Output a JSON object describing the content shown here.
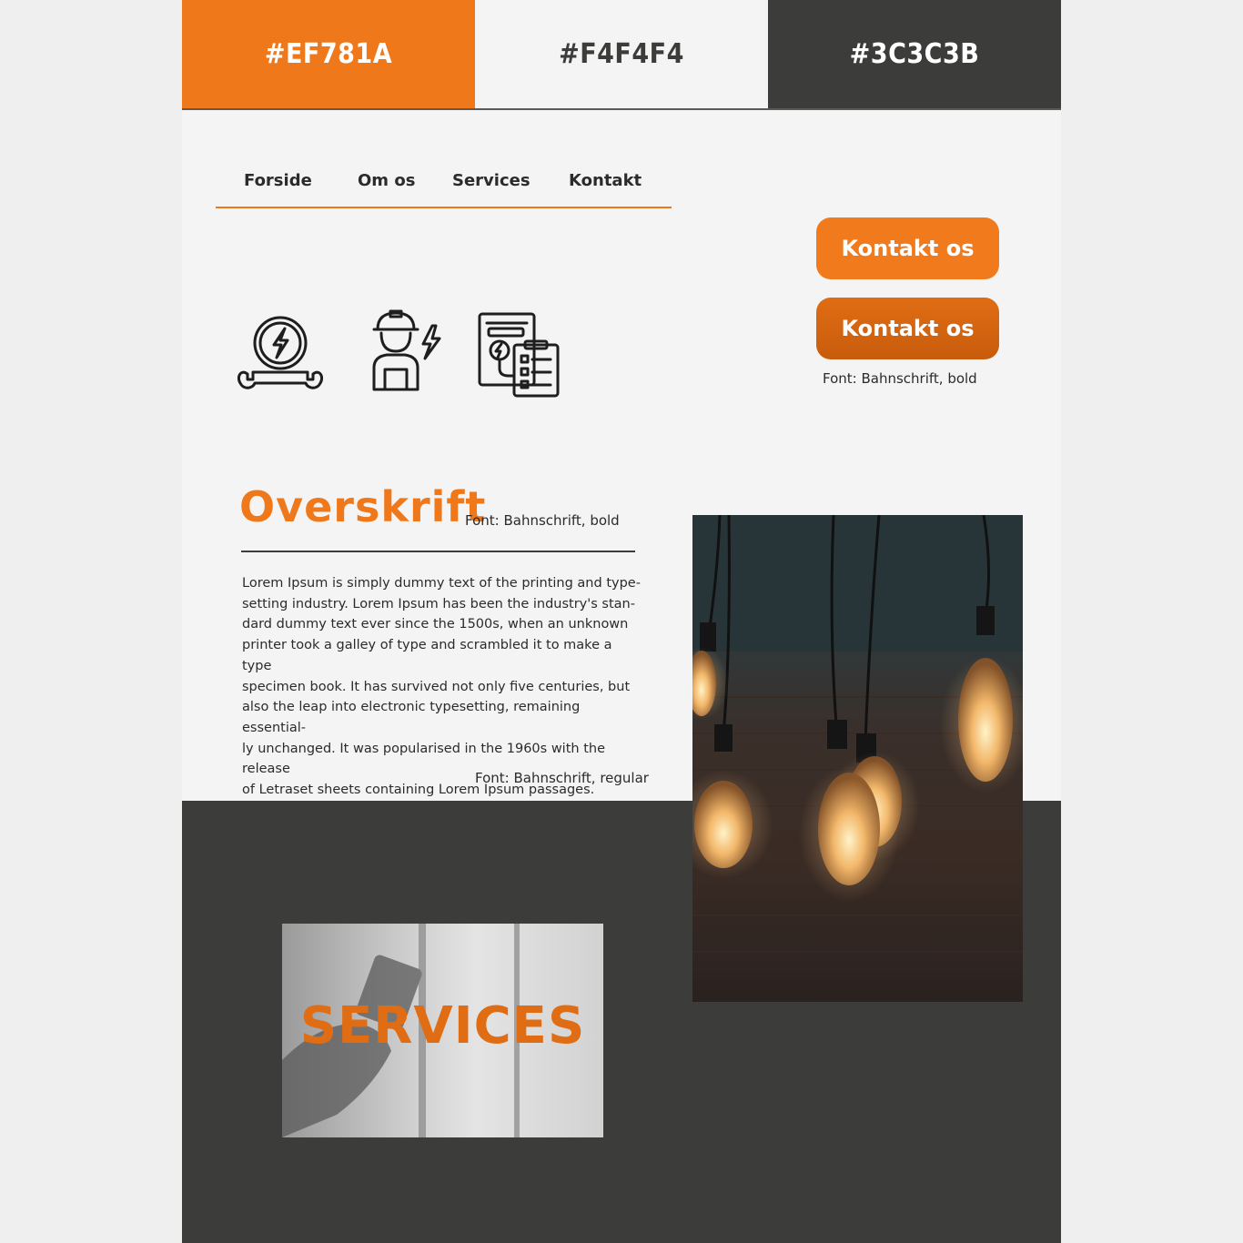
{
  "swatches": [
    {
      "label": "#EF781A",
      "color": "#EF781A"
    },
    {
      "label": "#F4F4F4",
      "color": "#F4F4F4"
    },
    {
      "label": "#3C3C3B",
      "color": "#3C3C3B"
    }
  ],
  "nav": {
    "items": [
      {
        "label": "Forside"
      },
      {
        "label": "Om os"
      },
      {
        "label": "Services"
      },
      {
        "label": "Kontakt"
      }
    ]
  },
  "buttons": {
    "primary_label": "Kontakt os",
    "hover_label": "Kontakt os",
    "font_note": "Font: Bahnschrift, bold"
  },
  "icons": [
    "electric-repair-icon",
    "electrician-worker-icon",
    "electrical-checklist-icon"
  ],
  "content": {
    "heading": "Overskrift",
    "heading_font_note": "Font: Bahnschrift, bold",
    "body_lines": [
      "Lorem Ipsum is simply dummy text of the printing and type-",
      "setting industry. Lorem Ipsum has been the industry's stan-",
      "dard dummy text ever since the 1500s, when an unknown",
      "printer took a galley of type and scrambled it to make a type",
      "specimen book. It has survived not only five centuries, but",
      "also the leap into electronic typesetting, remaining essential-",
      "ly unchanged. It was popularised in the 1960s with the release",
      "of Letraset sheets containing Lorem Ipsum passages."
    ],
    "body_font_note": "Font: Bahnschrift, regular"
  },
  "services_tile": {
    "label": "SERVICES"
  },
  "colors": {
    "accent": "#EF781A",
    "background": "#F4F4F4",
    "dark": "#3C3C3B"
  }
}
